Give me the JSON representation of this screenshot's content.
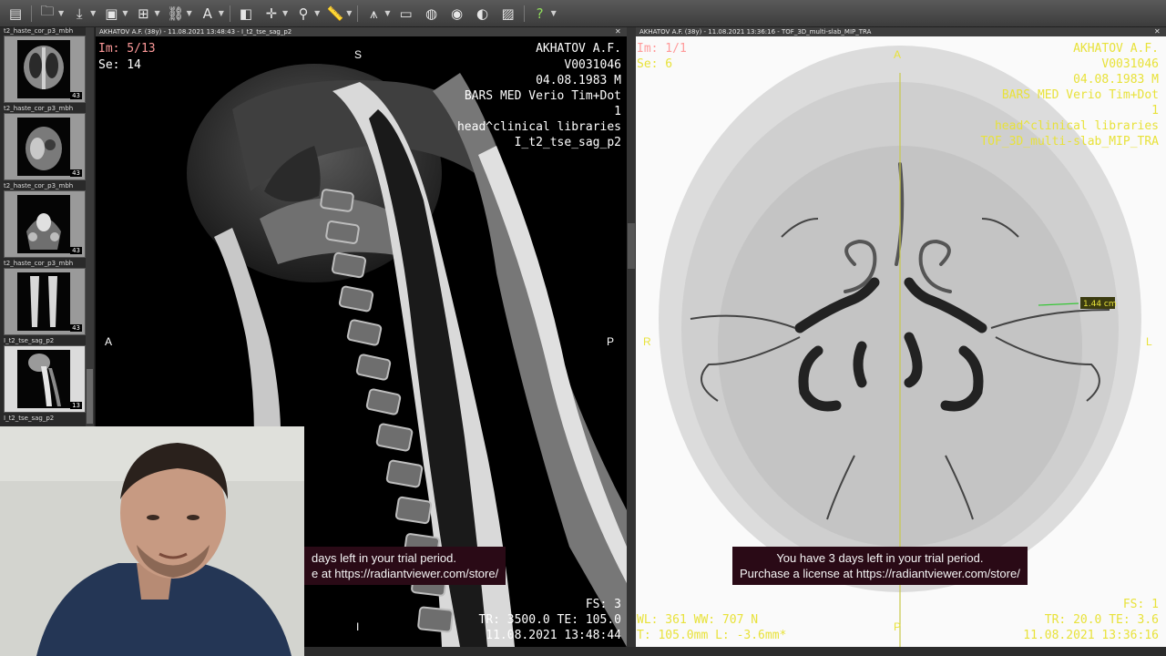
{
  "toolbar": {
    "buttons": [
      "layout-icon",
      "open-folder-icon",
      "download-icon",
      "save-icon",
      "grid-icon",
      "link-icon",
      "annotate-text-icon",
      "cube-icon",
      "crosshair-icon",
      "magnifier-icon",
      "measure-ruler-icon",
      "fusion-icon",
      "monitor-icon",
      "sphere-icon",
      "cd-icon",
      "compare-icon",
      "panel-icon",
      "question-icon"
    ]
  },
  "series": [
    {
      "label": "t2_haste_cor_p3_mbh",
      "count": "43"
    },
    {
      "label": "t2_haste_cor_p3_mbh",
      "count": "43"
    },
    {
      "label": "t2_haste_cor_p3_mbh",
      "count": "43"
    },
    {
      "label": "t2_haste_cor_p3_mbh",
      "count": "43"
    },
    {
      "label": "I_t2_tse_sag_p2",
      "count": "13"
    },
    {
      "label": "I_t2_tse_sag_p2",
      "count": ""
    }
  ],
  "left_view": {
    "title": "AKHATOV A.F. (38y) - 11.08.2021 13:48:43 - I_t2_tse_sag_p2",
    "image_index": "Im: 5/13",
    "series_index": "Se: 14",
    "patient_name": "AKHATOV A.F.",
    "patient_id": "V0031046",
    "birth": "04.08.1983 M",
    "device": "BARS MED Verio Tim+Dot",
    "study_no": "1",
    "library": "head^clinical libraries",
    "series_name": "I_t2_tse_sag_p2",
    "orient_top": "S",
    "orient_left": "A",
    "orient_right": "P",
    "orient_bottom": "I",
    "fs": "FS: 3",
    "tr_te": "TR: 3500.0 TE: 105.0",
    "datetime": "11.08.2021 13:48:44",
    "trial_line1": "days left in your trial period.",
    "trial_line2": "e at https://radiantviewer.com/store/"
  },
  "right_view": {
    "title": "AKHATOV A.F. (38y) - 11.08.2021 13:36:16 - TOF_3D_multi-slab_MIP_TRA",
    "image_index": "Im: 1/1",
    "series_index": "Se: 6",
    "patient_name": "AKHATOV A.F.",
    "patient_id": "V0031046",
    "birth": "04.08.1983 M",
    "device": "BARS MED Verio Tim+Dot",
    "study_no": "1",
    "library": "head^clinical libraries",
    "series_name": "TOF_3D_multi-slab_MIP_TRA",
    "orient_top": "A",
    "orient_left": "R",
    "orient_right": "L",
    "orient_bottom": "P",
    "measurement": "1.44 cm",
    "wl_ww": "WL: 361 WW: 707 N",
    "thickness": "T: 105.0mm L: -3.6mm*",
    "fs": "FS: 1",
    "tr_te": "TR: 20.0 TE: 3.6",
    "datetime": "11.08.2021 13:36:16",
    "trial_line1": "You have 3 days left in your trial period.",
    "trial_line2": "Purchase a license at https://radiantviewer.com/store/"
  },
  "colors": {
    "overlay_left": "#ff9a9a",
    "overlay_white": "#ffffff",
    "overlay_yellow": "#e8e23a",
    "trial_bg": "#2a0a16"
  }
}
